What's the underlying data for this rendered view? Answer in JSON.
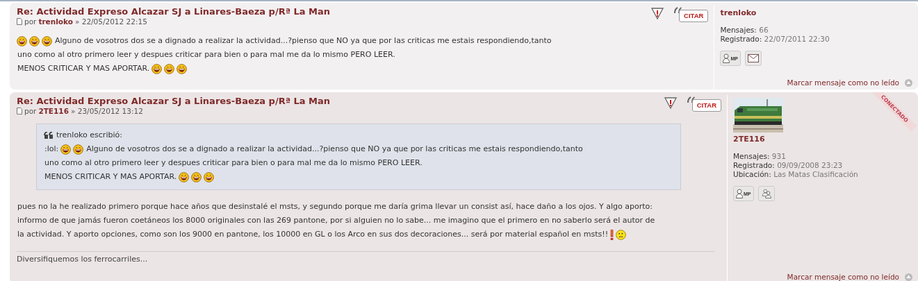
{
  "posts": [
    {
      "title": "Re: Actividad Expreso Alcazar SJ a Linares-Baeza p/Rª La Man",
      "by": "por",
      "author": "trenloko",
      "date": "» 22/05/2012 22:15",
      "quote_button": "CITAR",
      "body": [
        [
          {
            "kind": "laugh"
          },
          {
            "kind": "laugh"
          },
          {
            "kind": "laugh"
          },
          {
            "kind": "text",
            "text": "Alguno de vosotros dos se a dignado a realizar la actividad...?pienso que NO ya que por las criticas me estais respondiendo,tanto"
          }
        ],
        [
          {
            "kind": "text",
            "text": "uno como al otro primero leer y despues criticar para bien o para mal me da lo mismo PERO LEER."
          }
        ],
        [
          {
            "kind": "text",
            "text": "MENOS CRITICAR Y MAS APORTAR."
          },
          {
            "kind": "laugh"
          },
          {
            "kind": "laugh"
          },
          {
            "kind": "laugh"
          }
        ]
      ],
      "profile": {
        "username": "trenloko",
        "stats": [
          {
            "label": "Mensajes:",
            "value": "66"
          },
          {
            "label": "Registrado:",
            "value": "22/07/2011 22:30"
          }
        ],
        "buttons": [
          {
            "kind": "pm",
            "label": "MP"
          },
          {
            "kind": "email"
          }
        ]
      },
      "mark_unread": "Marcar mensaje como no leído"
    },
    {
      "title": "Re: Actividad Expreso Alcazar SJ a Linares-Baeza p/Rª La Man",
      "by": "por",
      "author": "2TE116",
      "date": "» 23/05/2012 13:12",
      "quote_button": "CITAR",
      "online": "CONECTADO",
      "quote": {
        "header": "trenloko escribió:",
        "lines": [
          [
            {
              "kind": "text",
              "text": ":lol:"
            },
            {
              "kind": "laugh"
            },
            {
              "kind": "laugh"
            },
            {
              "kind": "text",
              "text": "Alguno de vosotros dos se a dignado a realizar la actividad...?pienso que NO ya que por las criticas me estais respondiendo,tanto"
            }
          ],
          [
            {
              "kind": "text",
              "text": "uno como al otro primero leer y despues criticar para bien o para mal me da lo mismo PERO LEER."
            }
          ],
          [
            {
              "kind": "text",
              "text": "MENOS CRITICAR Y MAS APORTAR."
            },
            {
              "kind": "laugh"
            },
            {
              "kind": "laugh"
            },
            {
              "kind": "laugh"
            }
          ]
        ]
      },
      "body": [
        [
          {
            "kind": "text",
            "text": "pues no la he realizado primero porque hace años que desinstalé el msts, y segundo porque me daría grima llevar un consist así, hace daño a los ojos. Y algo aporto:"
          }
        ],
        [
          {
            "kind": "text",
            "text": "informo de que jamás fueron coetáneos los 8000 originales con las 269 pantone, por si alguien no lo sabe... me imagino que el primero en no saberlo será el autor de"
          }
        ],
        [
          {
            "kind": "text",
            "text": "la actividad. Y aporto opciones, como son los 9000 en pantone, los 10000 en GL o los Arco en sus dos decoraciones... será por material español en msts!!"
          },
          {
            "kind": "exclaim"
          },
          {
            "kind": "confused"
          }
        ]
      ],
      "signature": "Diversifiquemos los ferrocarriles...",
      "profile": {
        "username": "2TE116",
        "stats": [
          {
            "label": "Mensajes:",
            "value": "931"
          },
          {
            "label": "Registrado:",
            "value": "09/09/2008 23:23"
          },
          {
            "label": "Ubicación:",
            "value": "Las Matas Clasificación"
          }
        ],
        "buttons": [
          {
            "kind": "pm",
            "label": "MP"
          },
          {
            "kind": "friends"
          }
        ]
      },
      "mark_unread": "Marcar mensaje como no leído"
    }
  ]
}
